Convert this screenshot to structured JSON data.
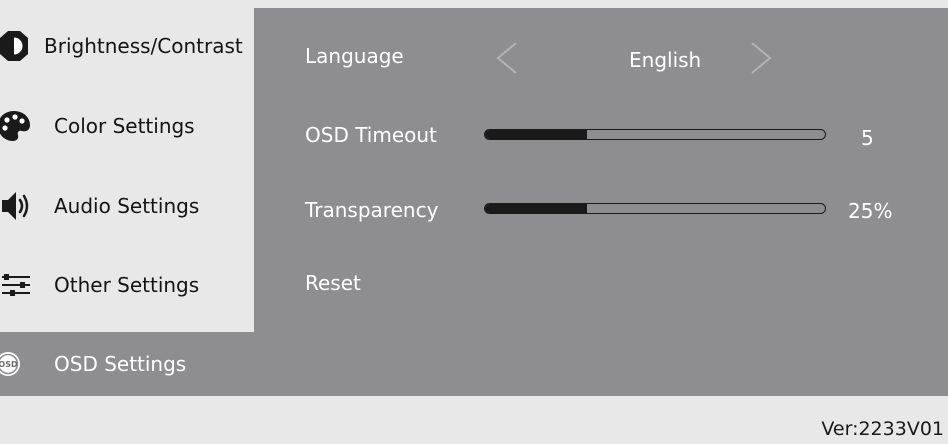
{
  "sidebar": {
    "items": [
      {
        "label": "Brightness/Contrast",
        "icon": "brightness-icon"
      },
      {
        "label": "Color Settings",
        "icon": "palette-icon"
      },
      {
        "label": "Audio Settings",
        "icon": "speaker-icon"
      },
      {
        "label": "Other Settings",
        "icon": "sliders-icon"
      },
      {
        "label": "OSD Settings",
        "icon": "osd-icon",
        "selected": true
      }
    ]
  },
  "main": {
    "language": {
      "label": "Language",
      "value": "English"
    },
    "osd_timeout": {
      "label": "OSD Timeout",
      "value": "5",
      "level": 0.3
    },
    "transparency": {
      "label": "Transparency",
      "value": "25%",
      "level": 0.3
    },
    "reset": {
      "label": "Reset"
    }
  },
  "footer": {
    "version": "Ver:2233V01"
  },
  "colors": {
    "panel": "#8e8e90",
    "background": "#e8e8e8",
    "text_dark": "#141414",
    "text_light": "#ffffff"
  }
}
